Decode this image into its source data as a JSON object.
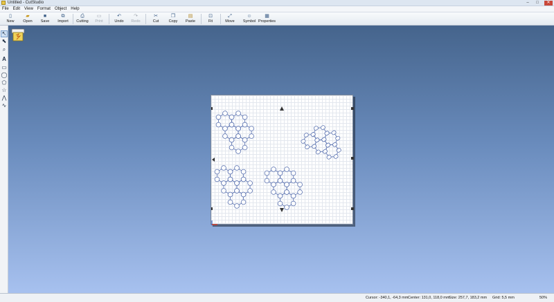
{
  "window": {
    "title": "Untitled - CutStudio"
  },
  "menu": [
    "File",
    "Edit",
    "View",
    "Format",
    "Object",
    "Help"
  ],
  "toolbar": {
    "new": "New",
    "open": "Open",
    "save": "Save",
    "import": "Import",
    "cutting": "Cutting",
    "print": "Print",
    "undo": "Undo",
    "redo": "Redo",
    "cut": "Cut",
    "copy": "Copy",
    "paste": "Paste",
    "fit": "Fit",
    "move": "Move",
    "symbol": "Symbol",
    "properties": "Properties"
  },
  "disabled_buttons": [
    "print",
    "redo"
  ],
  "tools": [
    "select-arrow",
    "node-edit-arrow",
    "zoom-magnifier",
    "text-A",
    "rectangle",
    "ellipse",
    "polygon",
    "star",
    "polyline",
    "freehand-curve"
  ],
  "status": {
    "cursor": "Cursor: -340,1, -64,3 mm",
    "center": "Center: 131,0, 118,0 mm",
    "size": "Size: 257,7, 183,2 mm",
    "grid": "Grid: 5,5 mm",
    "zoom": "50%"
  },
  "colors": {
    "canvas_top": "#45648c",
    "canvas_bottom": "#a7c1ef",
    "shape_stroke": "#5a72b0",
    "sheet_grid": "#e3e7ee"
  }
}
